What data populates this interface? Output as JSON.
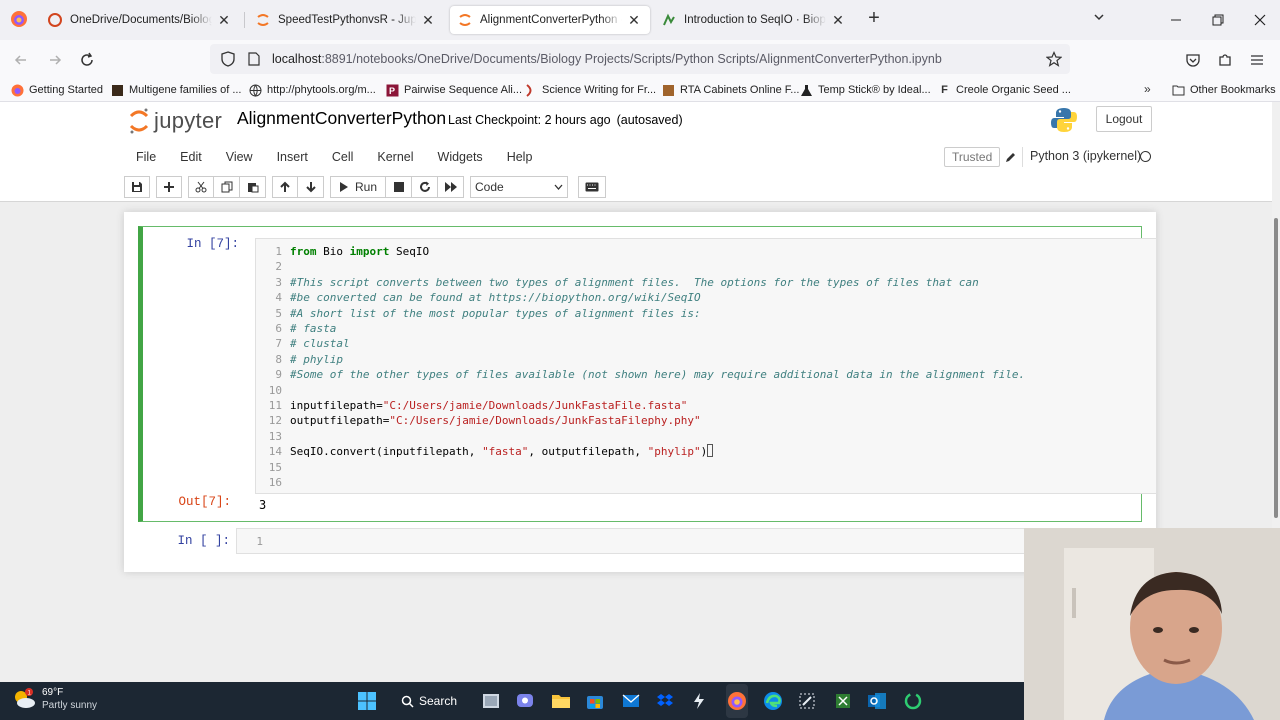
{
  "browser": {
    "tabs": [
      {
        "title": "OneDrive/Documents/Biology Pr",
        "favicon": "onedrive-icon",
        "active": false
      },
      {
        "title": "SpeedTestPythonvsR - Jupyter N",
        "favicon": "jupyter-icon",
        "active": false
      },
      {
        "title": "AlignmentConverterPython - Jupy",
        "favicon": "jupyter-icon",
        "active": true
      },
      {
        "title": "Introduction to SeqIO · Biopytho",
        "favicon": "biopython-icon",
        "active": false
      }
    ],
    "url": {
      "host": "localhost",
      "rest": ":8891/notebooks/OneDrive/Documents/Biology Projects/Scripts/Python Scripts/AlignmentConverterPython.ipynb"
    },
    "bookmarks": [
      {
        "label": "Getting Started",
        "icon": "firefox-icon"
      },
      {
        "label": "Multigene families of ...",
        "icon": "book-icon"
      },
      {
        "label": "http://phytools.org/m...",
        "icon": "globe-icon"
      },
      {
        "label": "Pairwise Sequence Ali...",
        "icon": "ebi-icon"
      },
      {
        "label": "Science Writing for Fr...",
        "icon": "sci-icon"
      },
      {
        "label": "RTA Cabinets Online F...",
        "icon": "cabinet-icon"
      },
      {
        "label": "Temp Stick® by Ideal...",
        "icon": "flask-icon"
      },
      {
        "label": "Creole Organic Seed ...",
        "icon": "seed-icon"
      }
    ],
    "other_bookmarks": "Other Bookmarks"
  },
  "jupyter": {
    "logo_text": "jupyter",
    "notebook_name": "AlignmentConverterPython",
    "checkpoint": "Last Checkpoint: 2 hours ago",
    "save_status": "(autosaved)",
    "logout": "Logout",
    "menu": [
      "File",
      "Edit",
      "View",
      "Insert",
      "Cell",
      "Kernel",
      "Widgets",
      "Help"
    ],
    "trusted": "Trusted",
    "kernel": "Python 3 (ipykernel)",
    "toolbar": {
      "run": "Run",
      "cell_type": "Code"
    }
  },
  "cells": {
    "cell1": {
      "in_prompt": "In [7]:",
      "out_prompt": "Out[7]:",
      "output": "3",
      "line_numbers": [
        "1",
        "2",
        "3",
        "4",
        "5",
        "6",
        "7",
        "8",
        "9",
        "10",
        "11",
        "12",
        "13",
        "14",
        "15",
        "16"
      ],
      "code": {
        "l1_kw1": "from",
        "l1_mod": " Bio ",
        "l1_kw2": "import",
        "l1_name": " SeqIO",
        "l3": "#This script converts between two types of alignment files.  The options for the types of files that can",
        "l4": "#be converted can be found at https://biopython.org/wiki/SeqIO",
        "l5": "#A short list of the most popular types of alignment files is:",
        "l6": "# fasta",
        "l7": "# clustal",
        "l8": "# phylip",
        "l9": "#Some of the other types of files available (not shown here) may require additional data in the alignment file.",
        "l11_name": "inputfilepath=",
        "l11_str": "\"C:/Users/jamie/Downloads/JunkFastaFile.fasta\"",
        "l12_name": "outputfilepath=",
        "l12_str": "\"C:/Users/jamie/Downloads/JunkFastaFilephy.phy\"",
        "l14_a": "SeqIO.convert(inputfilepath, ",
        "l14_s1": "\"fasta\"",
        "l14_b": ", outputfilepath, ",
        "l14_s2": "\"phylip\"",
        "l14_c": ")"
      }
    },
    "cell2": {
      "in_prompt": "In [ ]:",
      "line_number": "1"
    }
  },
  "taskbar": {
    "weather_temp": "69°F",
    "weather_desc": "Partly sunny",
    "weather_badge": "1",
    "search": "Search"
  },
  "colors": {
    "selected_cell_border": "#42a545",
    "in_prompt": "#303f9f",
    "out_prompt": "#d84315",
    "keyword": "#008000",
    "comment": "#408080",
    "string": "#ba2121"
  }
}
